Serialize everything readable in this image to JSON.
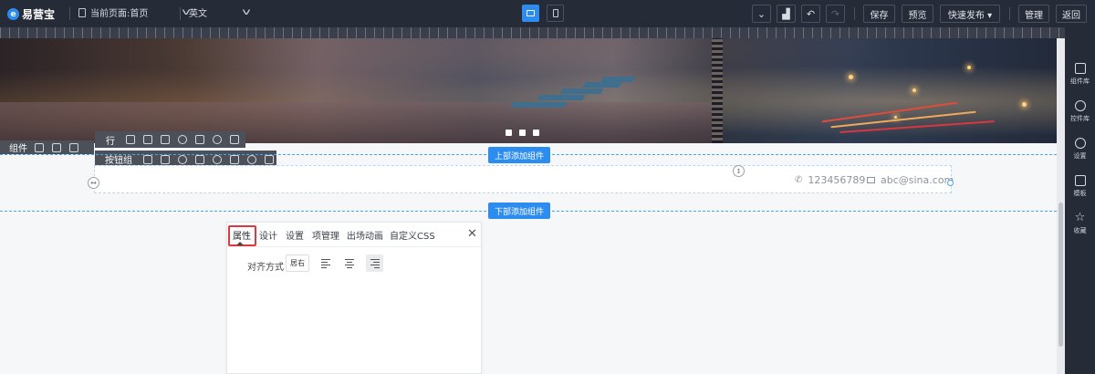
{
  "topbar": {
    "logo_text": "易营宝",
    "logo_mark": "e",
    "current_page": "当前页面:首页",
    "language": "英文",
    "undo_icon": "↶",
    "redo_icon": "↷",
    "buttons": {
      "save": "保存",
      "preview": "预览",
      "quick_publish": "快速发布 ▾",
      "manage": "管理",
      "back": "返回"
    }
  },
  "banner": {
    "slides": 3
  },
  "component_bar": {
    "label": "组件"
  },
  "row_toolbar": {
    "label": "行"
  },
  "button_group_toolbar": {
    "label": "按钮组"
  },
  "add_top_label": "上部添加组件",
  "add_bottom_label": "下部添加组件",
  "contacts": {
    "phone": "123456789",
    "email": "abc@sina.com",
    "phone_icon": "✆"
  },
  "panel": {
    "tabs": [
      "属性",
      "设计",
      "设置",
      "项管理",
      "出场动画",
      "自定义CSS"
    ],
    "active_tab": "属性",
    "close_icon": "✕",
    "align_label": "对齐方式",
    "align_value": "居右",
    "align_options": [
      "left",
      "center",
      "right"
    ],
    "align_selected": "right"
  },
  "sidebar": {
    "items": [
      {
        "label": "组件库",
        "icon": "layers-icon"
      },
      {
        "label": "控件库",
        "icon": "puzzle-icon"
      },
      {
        "label": "设置",
        "icon": "gear-icon"
      },
      {
        "label": "模板",
        "icon": "template-icon"
      },
      {
        "label": "收藏",
        "icon": "star-icon"
      }
    ]
  },
  "colors": {
    "accent": "#2d8cf0",
    "topbar": "#262b38",
    "highlight": "#e0383e"
  }
}
